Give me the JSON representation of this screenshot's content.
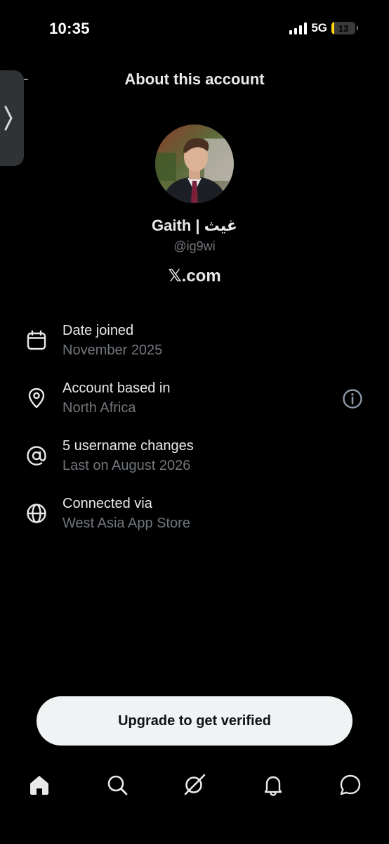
{
  "status_bar": {
    "time": "10:35",
    "network": "5G",
    "battery_level": "13",
    "battery_fraction": 0.13,
    "battery_color": "#ffd60a"
  },
  "header": {
    "title": "About this account",
    "back_icon": "chevron-right-icon"
  },
  "profile": {
    "display_name": "Gaith | غيث",
    "handle": "@ig9wi",
    "brand": "𝕏.com"
  },
  "info_rows": [
    {
      "icon": "calendar-icon",
      "title": "Date joined",
      "subtitle": "November 2025"
    },
    {
      "icon": "location-pin-icon",
      "title": "Account based in",
      "subtitle": "North Africa"
    },
    {
      "icon": "at-sign-icon",
      "title": "5 username changes",
      "subtitle": "Last on August 2026"
    },
    {
      "icon": "globe-icon",
      "title": "Connected via",
      "subtitle": "West Asia App Store"
    }
  ],
  "upgrade_button": {
    "label": "Upgrade to get verified"
  },
  "bottom_nav": [
    {
      "icon": "home-icon"
    },
    {
      "icon": "search-icon"
    },
    {
      "icon": "grok-icon"
    },
    {
      "icon": "bell-icon"
    },
    {
      "icon": "messages-icon"
    }
  ],
  "colors": {
    "background": "#000000",
    "primary_text": "#e7e9ea",
    "secondary_text": "#71767b",
    "button_bg": "#eff3f4"
  }
}
